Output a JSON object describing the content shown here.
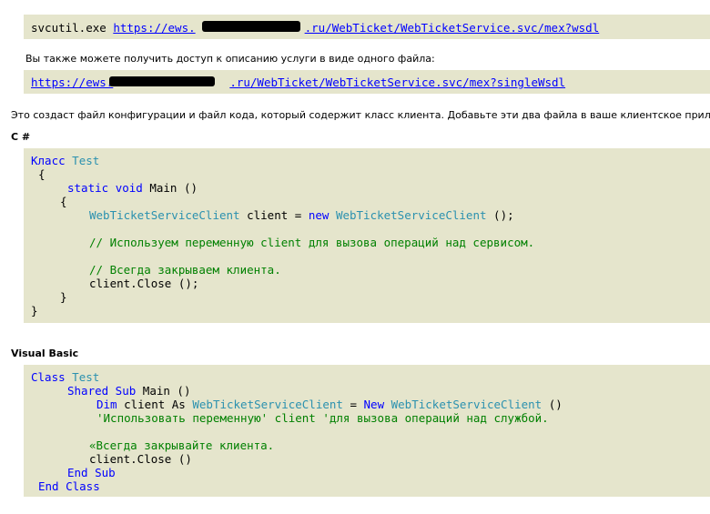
{
  "svcutil": {
    "command": "svcutil.exe ",
    "url_prefix": "https://ews.",
    "url_suffix": ".ru/WebTicket/WebTicketService.svc/mex?wsdl"
  },
  "single_file": {
    "intro": "Вы также можете получить доступ к описанию услуги в виде одного файла:",
    "url_prefix": "https://ews.",
    "url_suffix": ".ru/WebTicket/WebTicketService.svc/mex?singleWsdl"
  },
  "description": "Это создаст файл конфигурации и файл кода, который содержит класс клиента. Добавьте эти два файла в ваше клиентское прило",
  "csharp": {
    "heading": "C #",
    "lines": {
      "l1_kw": "Класс",
      "l1_name": " Test",
      "l2": "{",
      "l3_kw1": "static",
      "l3_kw2": "void",
      "l3_rest": " Main ()",
      "l4": "{",
      "l5_type": "WebTicketServiceClient",
      "l5_mid": " client = ",
      "l5_kw": "new",
      "l5_type2": " WebTicketServiceClient",
      "l5_end": " ();",
      "l6": "// Используем переменную client для вызова операций над сервисом.",
      "l7": "// Всегда закрываем клиента.",
      "l8": "client.Close ();",
      "l9": "}",
      "l10": "}"
    }
  },
  "vb": {
    "heading": "Visual Basic",
    "lines": {
      "l1_kw": "Class",
      "l1_name": " Test",
      "l2_kw": "Shared Sub",
      "l2_rest": " Main ()",
      "l3_kw": "Dim",
      "l3_mid": " client As ",
      "l3_type": "WebTicketServiceClient",
      "l3_eq": " = ",
      "l3_kw2": "New",
      "l3_type2": " WebTicketServiceClient",
      "l3_end": " ()",
      "l4": "'Использовать переменную' client 'для вызова операций над службой.",
      "l5": "«Всегда закрывайте клиента.",
      "l6": "client.Close ()",
      "l7": "End Sub",
      "l8": "End Class"
    }
  }
}
